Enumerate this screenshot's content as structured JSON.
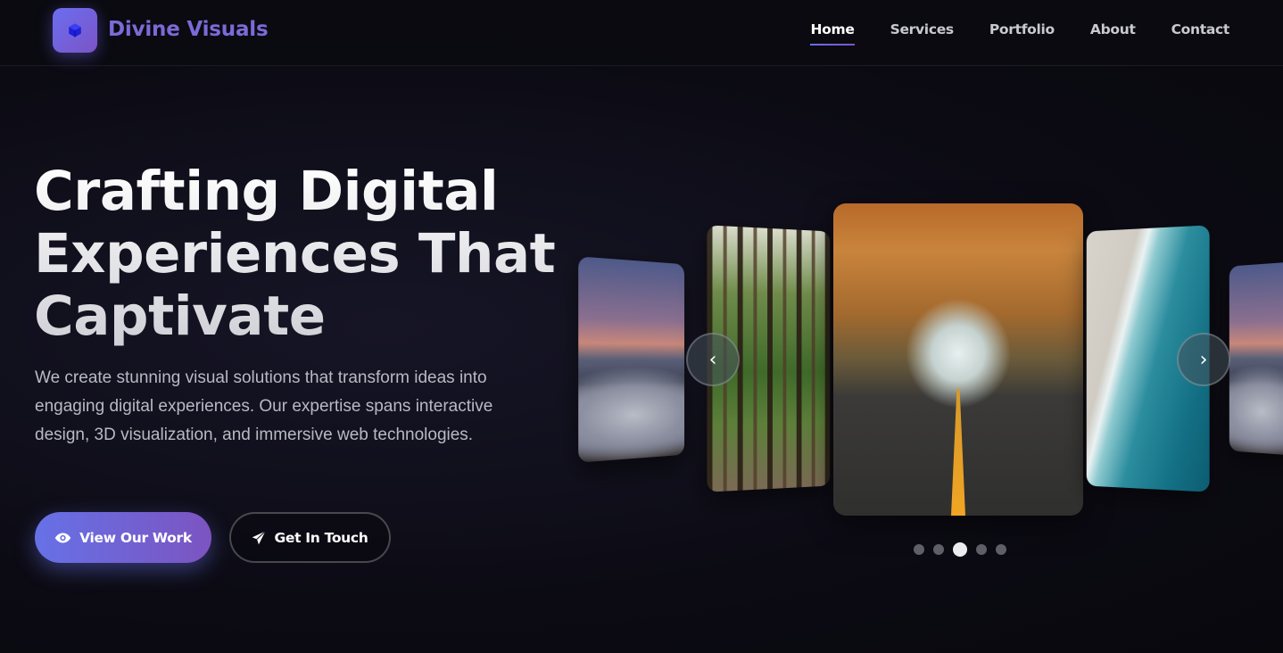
{
  "brand": {
    "name": "Divine Visuals",
    "logo_icon": "cube-icon"
  },
  "nav": {
    "items": [
      {
        "label": "Home",
        "active": true
      },
      {
        "label": "Services",
        "active": false
      },
      {
        "label": "Portfolio",
        "active": false
      },
      {
        "label": "About",
        "active": false
      },
      {
        "label": "Contact",
        "active": false
      }
    ]
  },
  "hero": {
    "title_line1": "Crafting Digital",
    "title_line2": "Experiences That",
    "title_line3": "Captivate",
    "description": "We create stunning visual solutions that transform ideas into engaging digital experiences. Our expertise spans interactive design, 3D visualization, and immersive web technologies.",
    "primary_button": {
      "label": "View Our Work",
      "icon": "eye-icon"
    },
    "secondary_button": {
      "label": "Get In Touch",
      "icon": "paper-plane-icon"
    }
  },
  "carousel": {
    "slides": [
      "mountain-clouds",
      "forest-path",
      "autumn-road",
      "ocean-shore",
      "mountain-clouds"
    ],
    "active_index": 2,
    "prev_label": "‹",
    "next_label": "›",
    "dot_count": 5
  },
  "colors": {
    "accent_start": "#6a6ef0",
    "accent_end": "#7c54c6",
    "background": "#0c0b14"
  }
}
